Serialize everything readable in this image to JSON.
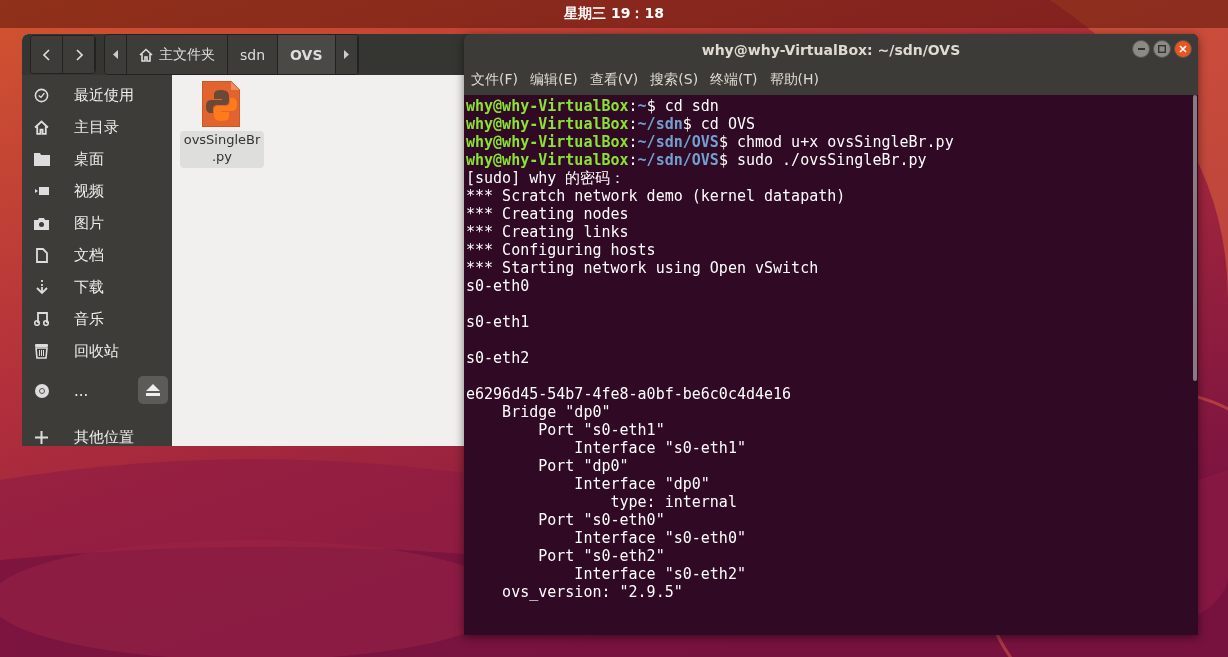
{
  "top_bar": {
    "clock": "星期三 19：18"
  },
  "file_manager": {
    "breadcrumbs": [
      {
        "label": "主文件夹",
        "kind": "home",
        "selected": false
      },
      {
        "label": "sdn",
        "kind": "folder",
        "selected": false
      },
      {
        "label": "OVS",
        "kind": "folder",
        "selected": true
      }
    ],
    "sidebar": [
      {
        "label": "最近使用",
        "kind": "clock"
      },
      {
        "label": "主目录",
        "kind": "home"
      },
      {
        "label": "桌面",
        "kind": "folder"
      },
      {
        "label": "视频",
        "kind": "video"
      },
      {
        "label": "图片",
        "kind": "camera"
      },
      {
        "label": "文档",
        "kind": "document"
      },
      {
        "label": "下载",
        "kind": "download"
      },
      {
        "label": "音乐",
        "kind": "music"
      },
      {
        "label": "回收站",
        "kind": "trash"
      },
      {
        "label": "...",
        "kind": "disc",
        "eject": true
      },
      {
        "label": "其他位置",
        "kind": "plus"
      }
    ],
    "files": [
      {
        "name": "ovsSingleBr\n.py",
        "selected": true
      }
    ]
  },
  "terminal": {
    "title": "why@why-VirtualBox: ~/sdn/OVS",
    "menu": [
      "文件(F)",
      "编辑(E)",
      "查看(V)",
      "搜索(S)",
      "终端(T)",
      "帮助(H)"
    ],
    "lines": [
      {
        "kind": "prompt",
        "user": "why@why-VirtualBox",
        "separator": ":",
        "path": "~",
        "symbol": "$",
        "command": "cd sdn"
      },
      {
        "kind": "prompt",
        "user": "why@why-VirtualBox",
        "separator": ":",
        "path": "~/sdn",
        "symbol": "$",
        "command": "cd OVS"
      },
      {
        "kind": "prompt",
        "user": "why@why-VirtualBox",
        "separator": ":",
        "path": "~/sdn/OVS",
        "symbol": "$",
        "command": "chmod u+x ovsSingleBr.py"
      },
      {
        "kind": "prompt",
        "user": "why@why-VirtualBox",
        "separator": ":",
        "path": "~/sdn/OVS",
        "symbol": "$",
        "command": "sudo ./ovsSingleBr.py"
      },
      {
        "kind": "output",
        "text": "[sudo] why 的密码："
      },
      {
        "kind": "output",
        "text": "*** Scratch network demo (kernel datapath)"
      },
      {
        "kind": "output",
        "text": "*** Creating nodes"
      },
      {
        "kind": "output",
        "text": "*** Creating links"
      },
      {
        "kind": "output",
        "text": "*** Configuring hosts"
      },
      {
        "kind": "output",
        "text": "*** Starting network using Open vSwitch"
      },
      {
        "kind": "output",
        "text": "s0-eth0"
      },
      {
        "kind": "blank"
      },
      {
        "kind": "output",
        "text": "s0-eth1"
      },
      {
        "kind": "blank"
      },
      {
        "kind": "output",
        "text": "s0-eth2"
      },
      {
        "kind": "blank"
      },
      {
        "kind": "output",
        "text": "e6296d45-54b7-4fe8-a0bf-be6c0c4d4e16"
      },
      {
        "kind": "output",
        "text": "    Bridge \"dp0\""
      },
      {
        "kind": "output",
        "text": "        Port \"s0-eth1\""
      },
      {
        "kind": "output",
        "text": "            Interface \"s0-eth1\""
      },
      {
        "kind": "output",
        "text": "        Port \"dp0\""
      },
      {
        "kind": "output",
        "text": "            Interface \"dp0\""
      },
      {
        "kind": "output",
        "text": "                type: internal"
      },
      {
        "kind": "output",
        "text": "        Port \"s0-eth0\""
      },
      {
        "kind": "output",
        "text": "            Interface \"s0-eth0\""
      },
      {
        "kind": "output",
        "text": "        Port \"s0-eth2\""
      },
      {
        "kind": "output",
        "text": "            Interface \"s0-eth2\""
      },
      {
        "kind": "output",
        "text": "    ovs_version: \"2.9.5\""
      }
    ]
  }
}
